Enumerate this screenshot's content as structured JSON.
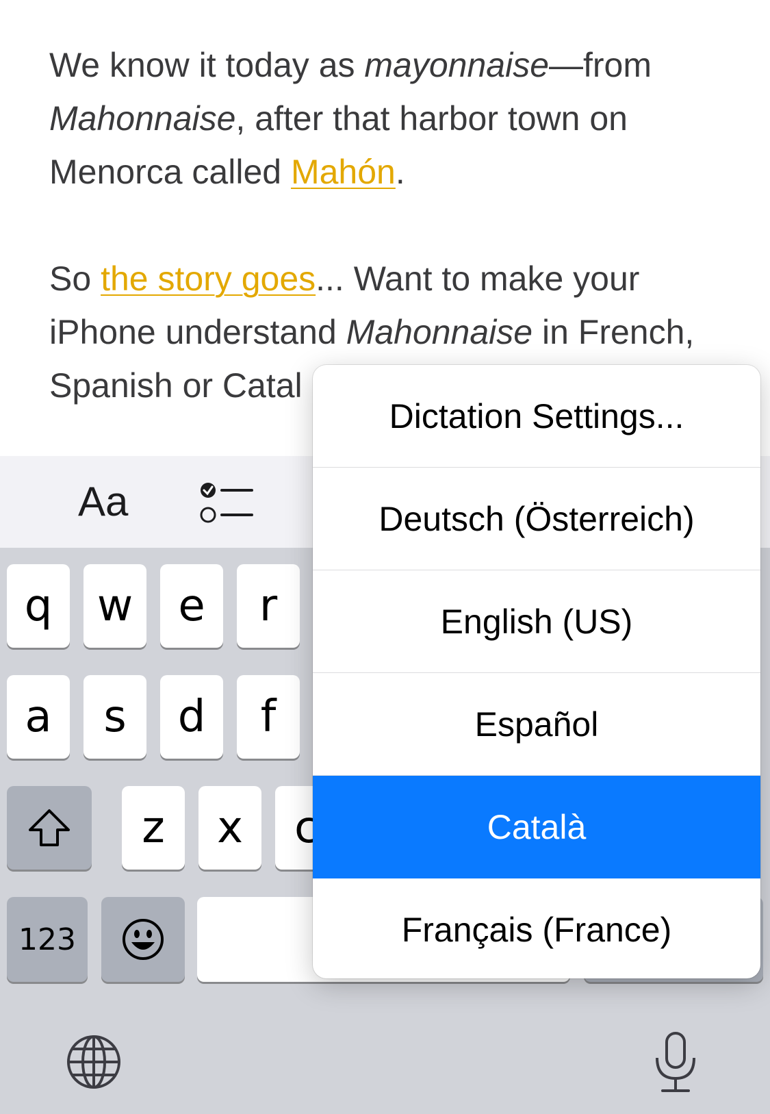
{
  "note": {
    "p1": {
      "t1": "We know it today as ",
      "i1": "mayonnaise",
      "t2": "—from ",
      "i2": "Mahonnaise",
      "t3": ", after that harbor town on Menorca called ",
      "link": "Mahón",
      "t4": "."
    },
    "p2": {
      "t1": "So ",
      "link": "the story goes",
      "t2": "... Want to make your iPhone understand ",
      "i1": "Mahonnaise",
      "t3": " in French, Spanish or Catal"
    }
  },
  "toolbar": {
    "format_label": "Aa",
    "checklist_icon": "checklist-icon"
  },
  "keyboard": {
    "row1": [
      "q",
      "w",
      "e",
      "r"
    ],
    "row2": [
      "a",
      "s",
      "d",
      "f"
    ],
    "row3": [
      "z",
      "x",
      "c"
    ],
    "numbers_label": "123",
    "shift_icon": "shift-icon",
    "emoji_icon": "emoji-icon",
    "globe_icon": "globe-icon",
    "mic_icon": "microphone-icon"
  },
  "menu": {
    "items": [
      "Dictation Settings...",
      "Deutsch (Österreich)",
      "English (US)",
      "Español",
      "Català",
      "Français (France)"
    ],
    "selected": "Català"
  },
  "colors": {
    "link": "#e3a800",
    "selected": "#0a7aff",
    "keyboard_bg": "#d1d3d9"
  }
}
